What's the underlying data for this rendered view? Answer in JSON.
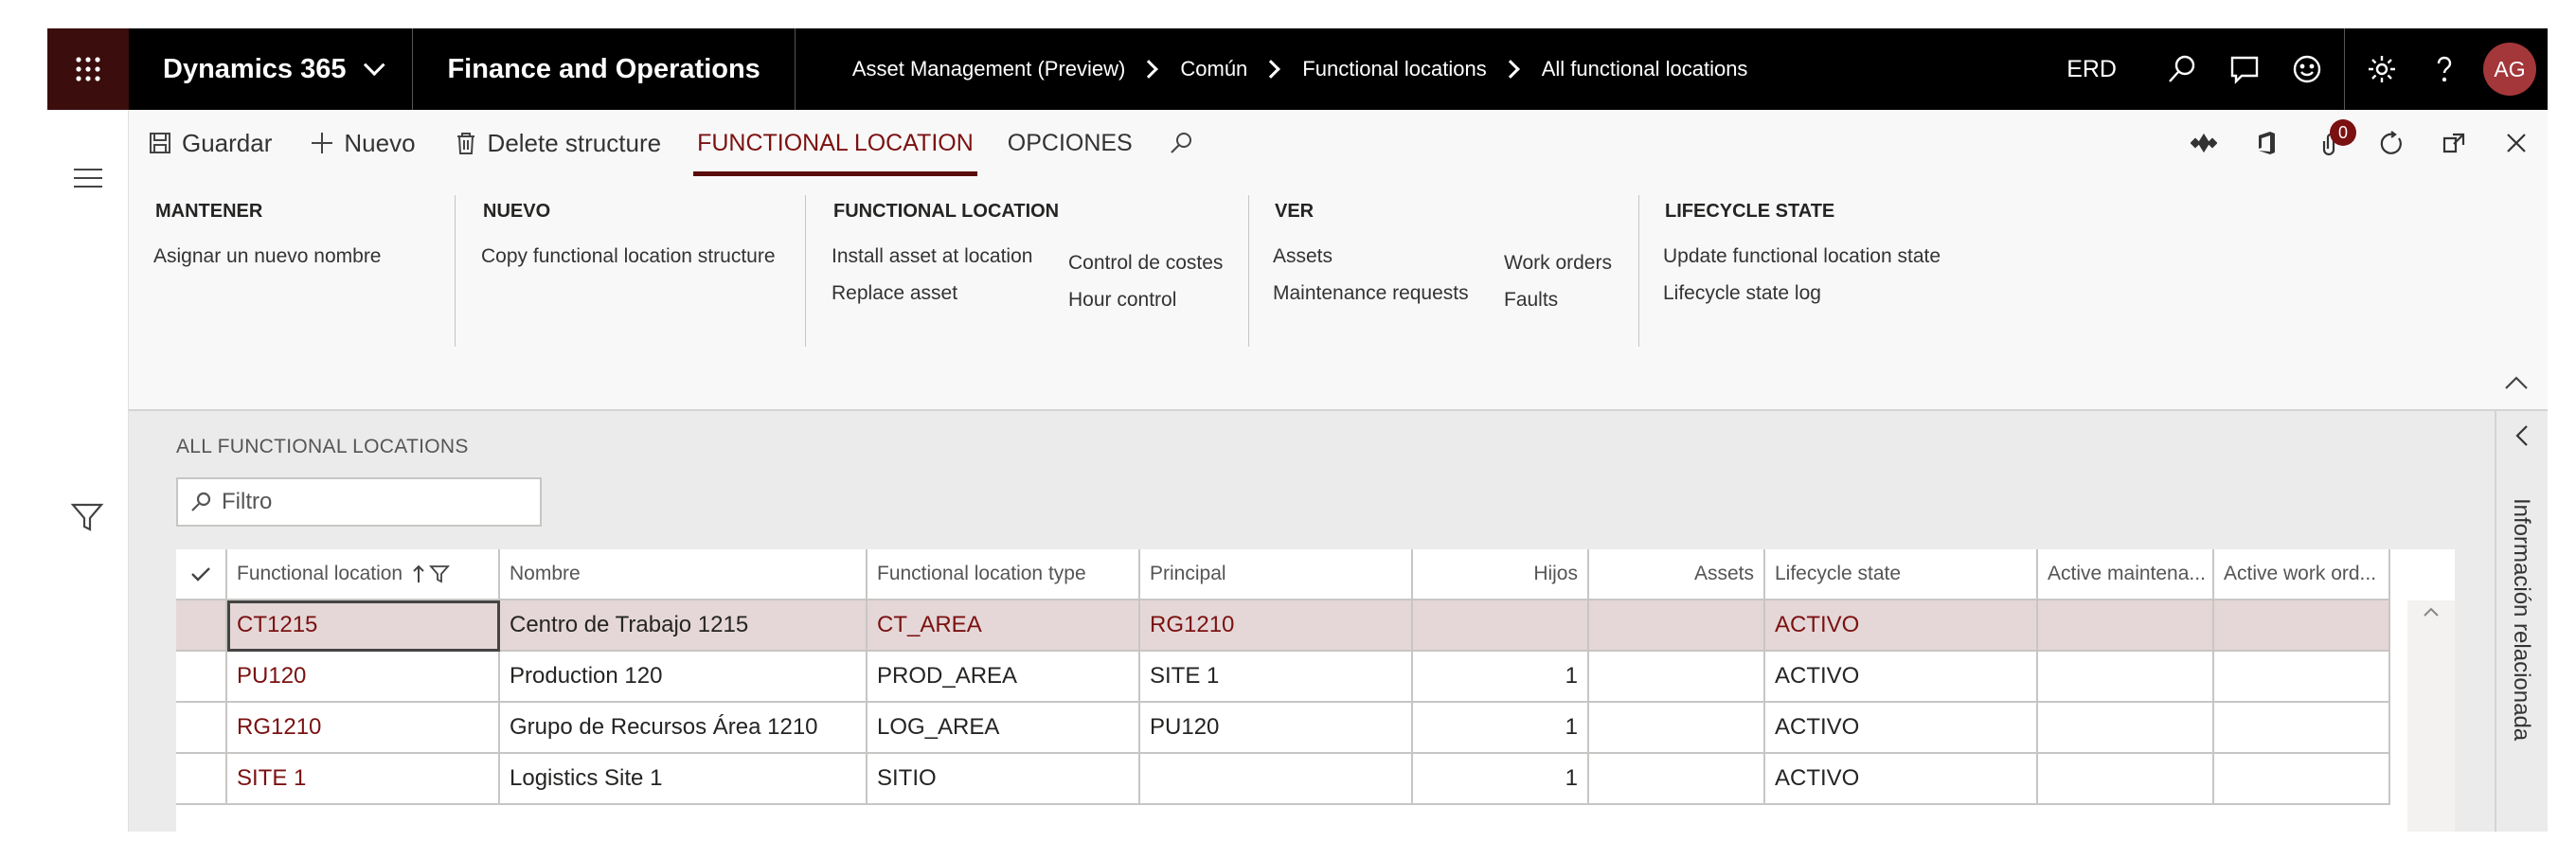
{
  "nav": {
    "brand": "Dynamics 365",
    "app": "Finance and Operations",
    "breadcrumbs": [
      "Asset Management (Preview)",
      "Común",
      "Functional locations",
      "All functional locations"
    ],
    "company": "ERD",
    "user_initials": "AG"
  },
  "actions": {
    "save": "Guardar",
    "new": "Nuevo",
    "delete": "Delete structure",
    "tabs": [
      "FUNCTIONAL LOCATION",
      "OPCIONES"
    ],
    "notification_count": "0"
  },
  "ribbon": {
    "mantener": {
      "title": "MANTENER",
      "items": [
        "Asignar un nuevo nombre"
      ]
    },
    "nuevo": {
      "title": "NUEVO",
      "items": [
        "Copy functional location structure"
      ]
    },
    "functional_location": {
      "title": "FUNCTIONAL LOCATION",
      "col1": [
        "Install asset at location",
        "Replace asset"
      ],
      "col2": [
        "Control de costes",
        "Hour control"
      ]
    },
    "ver": {
      "title": "VER",
      "col1": [
        "Assets",
        "Maintenance requests"
      ],
      "col2": [
        "Work orders",
        "Faults"
      ]
    },
    "lifecycle": {
      "title": "LIFECYCLE STATE",
      "items": [
        "Update functional location state",
        "Lifecycle state log"
      ]
    }
  },
  "content": {
    "section_title": "ALL FUNCTIONAL LOCATIONS",
    "filter_placeholder": "Filtro",
    "columns": [
      "Functional location",
      "Nombre",
      "Functional location type",
      "Principal",
      "Hijos",
      "Assets",
      "Lifecycle state",
      "Active maintena...",
      "Active work ord..."
    ],
    "rows": [
      {
        "loc": "CT1215",
        "name": "Centro de Trabajo 1215",
        "type": "CT_AREA",
        "parent": "RG1210",
        "children": "",
        "assets": "",
        "state": "ACTIVO",
        "am": "",
        "awo": ""
      },
      {
        "loc": "PU120",
        "name": "Production 120",
        "type": "PROD_AREA",
        "parent": "SITE 1",
        "children": "1",
        "assets": "",
        "state": "ACTIVO",
        "am": "",
        "awo": ""
      },
      {
        "loc": "RG1210",
        "name": "Grupo de Recursos Área 1210",
        "type": "LOG_AREA",
        "parent": "PU120",
        "children": "1",
        "assets": "",
        "state": "ACTIVO",
        "am": "",
        "awo": ""
      },
      {
        "loc": "SITE 1",
        "name": "Logistics Site 1",
        "type": "SITIO",
        "parent": "",
        "children": "1",
        "assets": "",
        "state": "ACTIVO",
        "am": "",
        "awo": ""
      }
    ],
    "related_pane": "Información relacionada"
  }
}
